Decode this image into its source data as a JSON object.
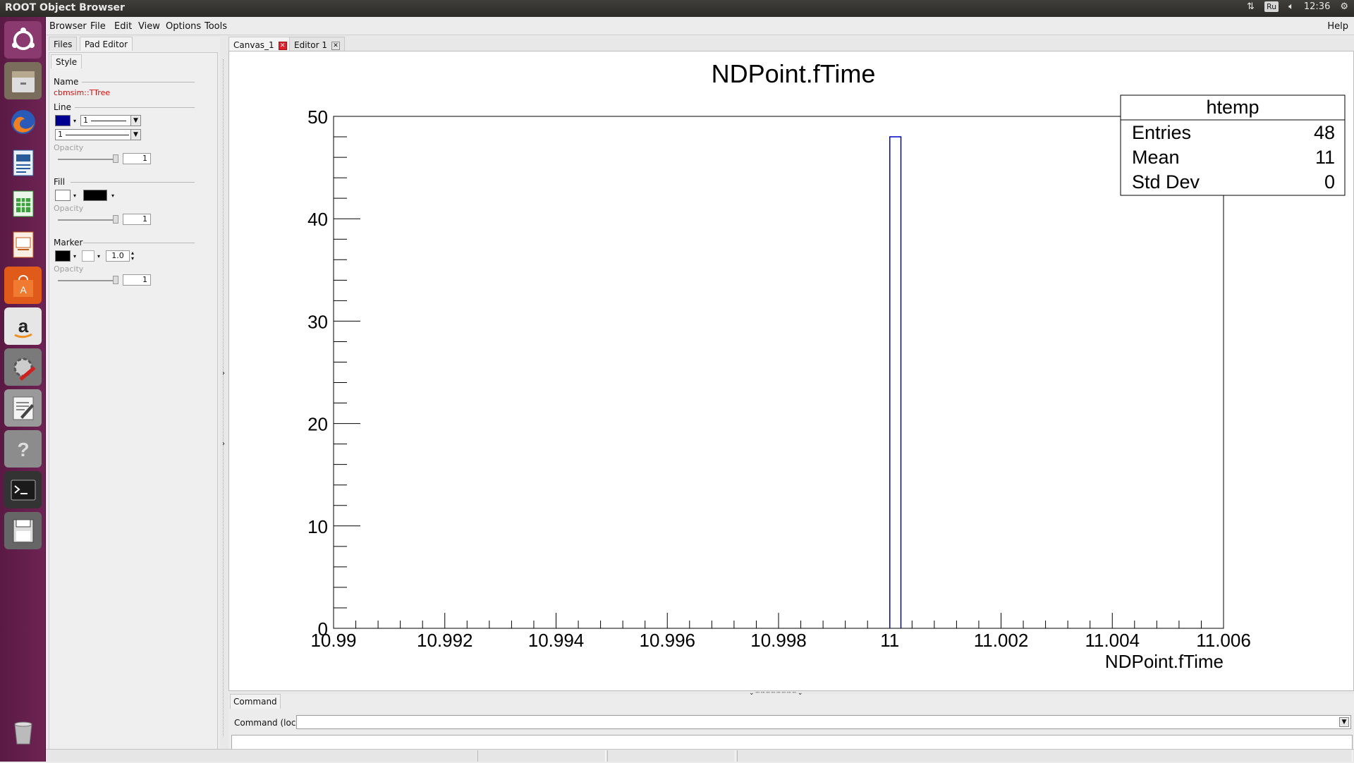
{
  "window": {
    "title": "ROOT Object Browser"
  },
  "tray": {
    "keyboard_layout": "Ru",
    "time": "12:36"
  },
  "menubar": {
    "items": [
      "Browser",
      "File",
      "Edit",
      "View",
      "Options",
      "Tools"
    ],
    "help": "Help"
  },
  "left_panel": {
    "tabs": [
      "Files",
      "Pad Editor"
    ],
    "subtab": "Style",
    "name_label": "Name",
    "name_value": "cbmsim::TTree",
    "line_label": "Line",
    "line_width": "1",
    "line_style": "1",
    "line_color": "#000090",
    "opacity_label": "Opacity",
    "line_opacity": "1",
    "fill_label": "Fill",
    "fill_color": "#ffffff",
    "fill_pattern_color": "#000000",
    "fill_opacity": "1",
    "marker_label": "Marker",
    "marker_color": "#000000",
    "marker_size": "1.0",
    "marker_opacity": "1"
  },
  "canvas_tabs": [
    "Canvas_1",
    "Editor 1"
  ],
  "command": {
    "tab": "Command",
    "label": "Command (local):",
    "value": ""
  },
  "chart_data": {
    "type": "bar",
    "title": "NDPoint.fTime",
    "xlabel": "NDPoint.fTime",
    "ylabel": "",
    "xlim": [
      10.99,
      11.006
    ],
    "ylim": [
      0,
      50
    ],
    "x_tick_labels": [
      "10.99",
      "10.992",
      "10.994",
      "10.996",
      "10.998",
      "11",
      "11.002",
      "11.004",
      "11.006"
    ],
    "y_tick_labels": [
      "0",
      "10",
      "20",
      "30",
      "40",
      "50"
    ],
    "bins": [
      {
        "x_low": 11.0,
        "x_high": 11.0002,
        "value": 48
      }
    ],
    "line_color": "#0000cc",
    "stats": {
      "name": "htemp",
      "rows": [
        {
          "label": "Entries",
          "value": "48"
        },
        {
          "label": "Mean",
          "value": "11"
        },
        {
          "label": "Std Dev",
          "value": "0"
        }
      ]
    }
  }
}
